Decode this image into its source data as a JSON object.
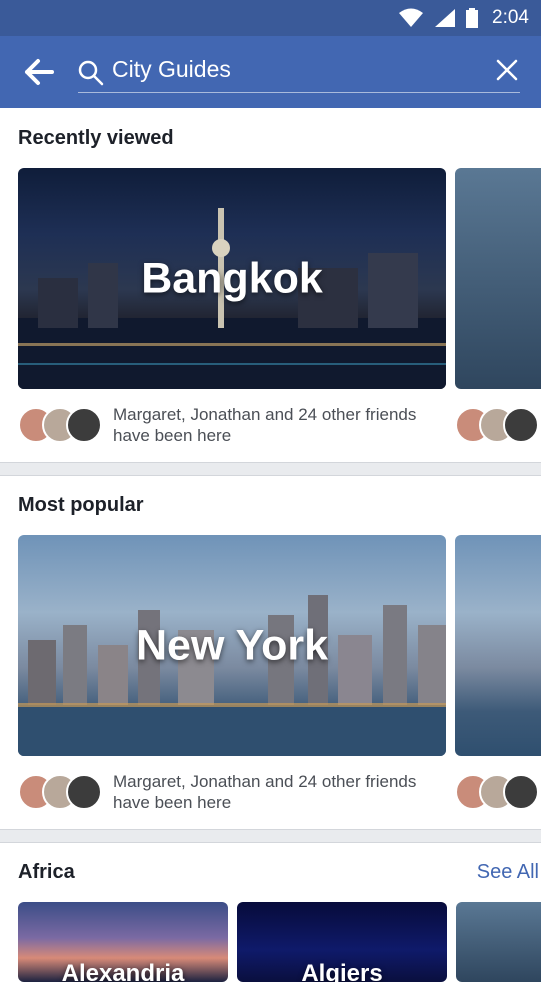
{
  "status_bar": {
    "time": "2:04"
  },
  "search": {
    "query": "City Guides"
  },
  "sections": [
    {
      "title": "Recently viewed",
      "city": "Bangkok",
      "friends_text": "Margaret, Jonathan and 24 other friends have been here"
    },
    {
      "title": "Most popular",
      "city": "New York",
      "friends_text": "Margaret, Jonathan and 24 other friends have been here"
    },
    {
      "title": "Africa",
      "see_all": "See All",
      "cities": [
        "Alexandria",
        "Algiers"
      ]
    }
  ]
}
